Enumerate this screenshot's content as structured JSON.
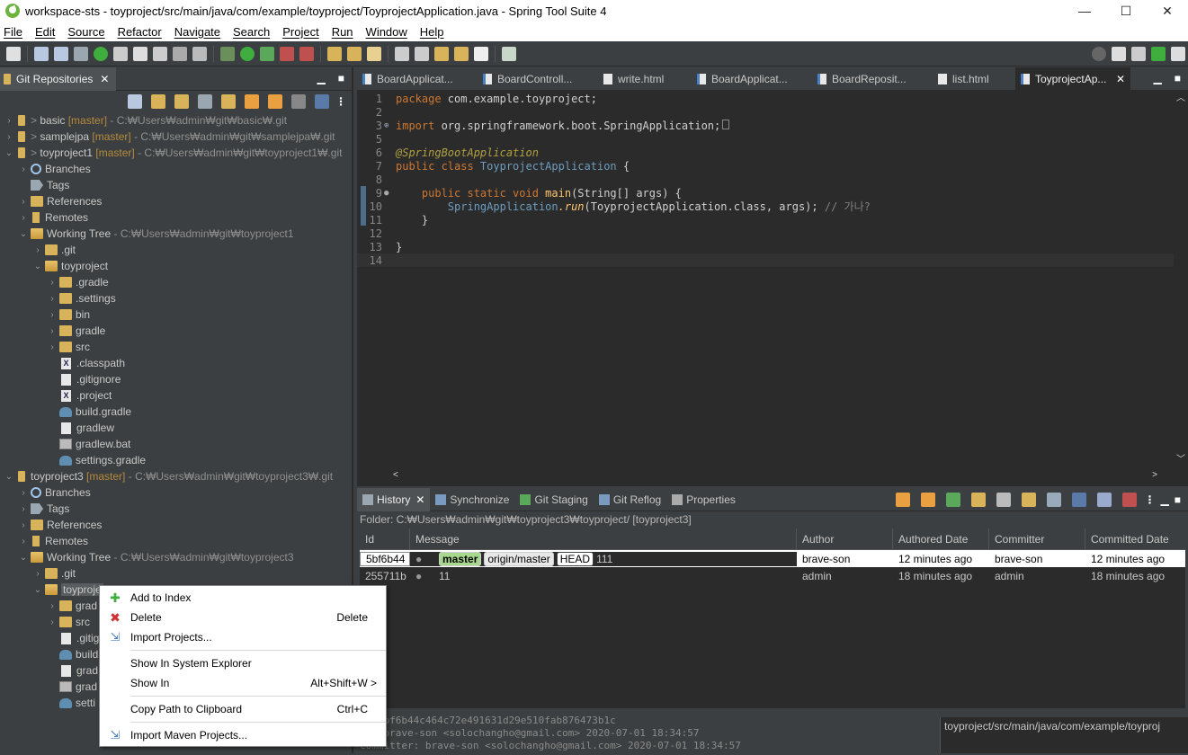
{
  "window": {
    "title": "workspace-sts - toyproject/src/main/java/com/example/toyproject/ToyprojectApplication.java - Spring Tool Suite 4",
    "controls": [
      "—",
      "☐",
      "✕"
    ]
  },
  "menu": [
    "File",
    "Edit",
    "Source",
    "Refactor",
    "Navigate",
    "Search",
    "Project",
    "Run",
    "Window",
    "Help"
  ],
  "git_view": {
    "tab_label": "Git Repositories",
    "tree": [
      {
        "text": "basic",
        "branch": "[master]",
        "path": "- C:₩Users₩admin₩git₩basic₩.git"
      },
      {
        "text": "samplejpa",
        "branch": "[master]",
        "path": "- C:₩Users₩admin₩git₩samplejpa₩.git"
      },
      {
        "text": "toyproject1",
        "branch": "[master]",
        "path": "- C:₩Users₩admin₩git₩toyproject1₩.git"
      },
      {
        "text": "Branches"
      },
      {
        "text": "Tags"
      },
      {
        "text": "References"
      },
      {
        "text": "Remotes"
      },
      {
        "text": "Working Tree",
        "path": "- C:₩Users₩admin₩git₩toyproject1"
      },
      {
        "text": ".git"
      },
      {
        "text": "toyproject"
      },
      {
        "text": ".gradle"
      },
      {
        "text": ".settings"
      },
      {
        "text": "bin"
      },
      {
        "text": "gradle"
      },
      {
        "text": "src"
      },
      {
        "text": ".classpath"
      },
      {
        "text": ".gitignore"
      },
      {
        "text": ".project"
      },
      {
        "text": "build.gradle"
      },
      {
        "text": "gradlew"
      },
      {
        "text": "gradlew.bat"
      },
      {
        "text": "settings.gradle"
      },
      {
        "text": "toyproject3",
        "branch": "[master]",
        "path": "- C:₩Users₩admin₩git₩toyproject3₩.git"
      },
      {
        "text": "Branches"
      },
      {
        "text": "Tags"
      },
      {
        "text": "References"
      },
      {
        "text": "Remotes"
      },
      {
        "text": "Working Tree",
        "path": "- C:₩Users₩admin₩git₩toyproject3"
      },
      {
        "text": ".git"
      },
      {
        "text": "toyproje"
      },
      {
        "text": "grad"
      },
      {
        "text": "src"
      },
      {
        "text": ".gitig"
      },
      {
        "text": "build"
      },
      {
        "text": "grad"
      },
      {
        "text": "grad"
      },
      {
        "text": "setti"
      }
    ]
  },
  "editor": {
    "tabs": [
      "BoardApplicat...",
      "BoardControll...",
      "write.html",
      "BoardApplicat...",
      "BoardReposit...",
      "list.html",
      "ToyprojectAp..."
    ],
    "lines": [
      "1",
      "2",
      "3",
      "5",
      "6",
      "7",
      "8",
      "9",
      "10",
      "11",
      "12",
      "13",
      "14"
    ],
    "code": {
      "l1_kw": "package",
      "l1_rest": " com.example.toyproject;",
      "l3_kw": "import",
      "l3_rest": " org.springframework.boot.SpringApplication;",
      "l5": "@SpringBootApplication",
      "l6_kw": "public class",
      "l6_cls": " ToyprojectApplication",
      "l6_rest": " {",
      "l9_kw": "    public static void",
      "l9_m": " main",
      "l9_rest": "(String[] args) {",
      "l10_cls": "        SpringApplication",
      "l10_m": ".run",
      "l10_rest": "(ToyprojectApplication.class, args);",
      "l10_cmt": " // 가나?",
      "l11": "    }",
      "l13": "}"
    }
  },
  "bottom": {
    "tabs": [
      "History",
      "Synchronize",
      "Git Staging",
      "Git Reflog",
      "Properties"
    ],
    "folder": "Folder: C:₩Users₩admin₩git₩toyproject3₩toyproject/ [toyproject3]",
    "columns": [
      "Id",
      "Message",
      "Author",
      "Authored Date",
      "Committer",
      "Committed Date"
    ],
    "rows": [
      {
        "id": "5bf6b44",
        "refs": [
          "master",
          "origin/master",
          "HEAD"
        ],
        "msg": "111",
        "author": "brave-son",
        "authored": "12 minutes ago",
        "committer": "brave-son",
        "committed": "12 minutes ago"
      },
      {
        "id": "255711b",
        "refs": [],
        "msg": "11",
        "author": "admin",
        "authored": "18 minutes ago",
        "committer": "admin",
        "committed": "18 minutes ago"
      }
    ],
    "commit_info": [
      "it 5bf6b44c464c72e491631d29e510fab876473b1c",
      "or: brave-son <solochangho@gmail.com> 2020-07-01 18:34:57",
      "Committer: brave-son <solochangho@gmail.com> 2020-07-01 18:34:57"
    ],
    "path_box": "toyproject/src/main/java/com/example/toyproj"
  },
  "context_menu": [
    {
      "label": "Add to Index",
      "shortcut": ""
    },
    {
      "label": "Delete",
      "shortcut": "Delete"
    },
    {
      "label": "Import Projects...",
      "shortcut": ""
    },
    {
      "label": "Show In System Explorer",
      "shortcut": ""
    },
    {
      "label": "Show In",
      "shortcut": "Alt+Shift+W >"
    },
    {
      "label": "Copy Path to Clipboard",
      "shortcut": "Ctrl+C"
    },
    {
      "label": "Import Maven Projects...",
      "shortcut": ""
    }
  ]
}
